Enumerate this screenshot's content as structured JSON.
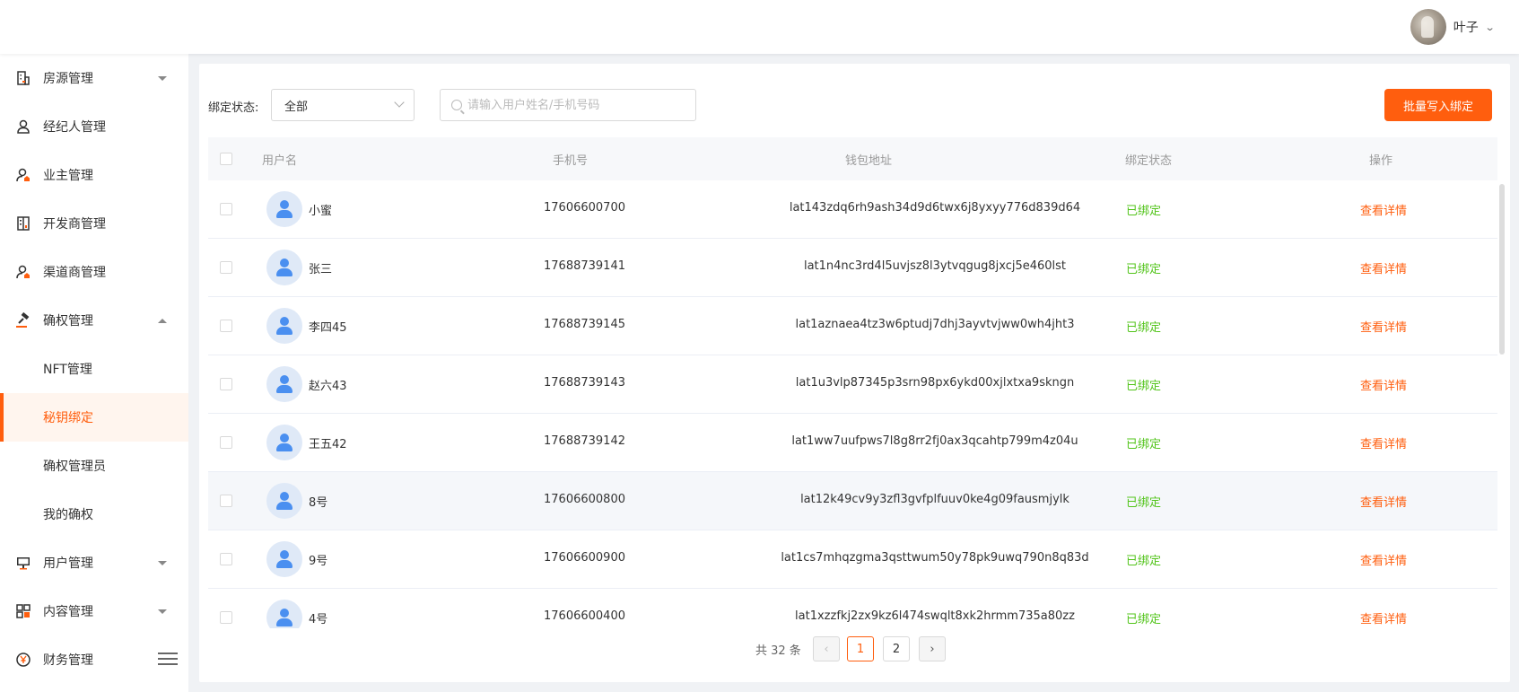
{
  "header": {
    "user_name": "叶子"
  },
  "sidebar": {
    "items": [
      {
        "label": "房源管理",
        "icon": "building-icon",
        "caret": "down"
      },
      {
        "label": "经纪人管理",
        "icon": "person-icon",
        "caret": ""
      },
      {
        "label": "业主管理",
        "icon": "person-home-icon",
        "caret": ""
      },
      {
        "label": "开发商管理",
        "icon": "office-building-icon",
        "caret": ""
      },
      {
        "label": "渠道商管理",
        "icon": "person-home-icon",
        "caret": ""
      },
      {
        "label": "确权管理",
        "icon": "gavel-icon",
        "caret": "up"
      },
      {
        "label": "NFT管理",
        "icon": "",
        "caret": ""
      },
      {
        "label": "秘钥绑定",
        "icon": "",
        "caret": "",
        "active": true
      },
      {
        "label": "确权管理员",
        "icon": "",
        "caret": ""
      },
      {
        "label": "我的确权",
        "icon": "",
        "caret": ""
      },
      {
        "label": "用户管理",
        "icon": "monitor-icon",
        "caret": "down"
      },
      {
        "label": "内容管理",
        "icon": "grid-icon",
        "caret": "down"
      },
      {
        "label": "财务管理",
        "icon": "yen-icon",
        "caret": ""
      }
    ]
  },
  "filters": {
    "status_label": "绑定状态:",
    "status_value": "全部",
    "search_placeholder": "请输入用户姓名/手机号码",
    "batch_button": "批量写入绑定"
  },
  "table": {
    "columns": [
      "用户名",
      "手机号",
      "钱包地址",
      "绑定状态",
      "操作"
    ],
    "rows": [
      {
        "name": "小蜜",
        "phone": "17606600700",
        "wallet": "lat143zdq6rh9ash34d9d6twx6j8yxyy776d839d64",
        "status": "已绑定",
        "action": "查看详情"
      },
      {
        "name": "张三",
        "phone": "17688739141",
        "wallet": "lat1n4nc3rd4l5uvjsz8l3ytvqgug8jxcj5e460lst",
        "status": "已绑定",
        "action": "查看详情"
      },
      {
        "name": "李四45",
        "phone": "17688739145",
        "wallet": "lat1aznaea4tz3w6ptudj7dhj3ayvtvjww0wh4jht3",
        "status": "已绑定",
        "action": "查看详情"
      },
      {
        "name": "赵六43",
        "phone": "17688739143",
        "wallet": "lat1u3vlp87345p3srn98px6ykd00xjlxtxa9skngn",
        "status": "已绑定",
        "action": "查看详情"
      },
      {
        "name": "王五42",
        "phone": "17688739142",
        "wallet": "lat1ww7uufpws7l8g8rr2fj0ax3qcahtp799m4z04u",
        "status": "已绑定",
        "action": "查看详情"
      },
      {
        "name": "8号",
        "phone": "17606600800",
        "wallet": "lat12k49cv9y3zfl3gvfplfuuv0ke4g09fausmjylk",
        "status": "已绑定",
        "action": "查看详情"
      },
      {
        "name": "9号",
        "phone": "17606600900",
        "wallet": "lat1cs7mhqzgma3qsttwum50y78pk9uwq790n8q83d",
        "status": "已绑定",
        "action": "查看详情"
      },
      {
        "name": "4号",
        "phone": "17606600400",
        "wallet": "lat1xzzfkj2zx9kz6l474swqlt8xk2hrmm735a80zz",
        "status": "已绑定",
        "action": "查看详情"
      }
    ]
  },
  "pagination": {
    "total": "共 32 条",
    "pages": [
      "1",
      "2"
    ],
    "current": "1"
  },
  "colors": {
    "accent": "#ff5e0e",
    "success": "#52c41a"
  }
}
